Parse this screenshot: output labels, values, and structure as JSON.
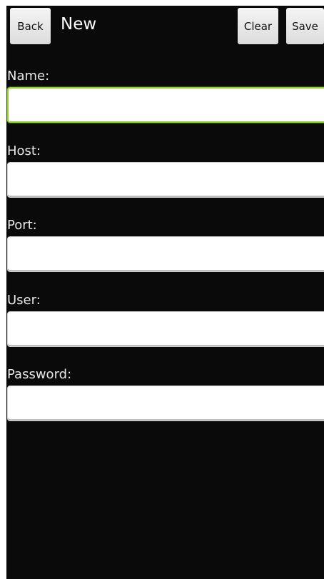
{
  "toolbar": {
    "back_label": "Back",
    "title": "New",
    "clear_label": "Clear",
    "save_label": "Save"
  },
  "form": {
    "name_label": "Name:",
    "name_value": "",
    "host_label": "Host:",
    "host_value": "",
    "port_label": "Port:",
    "port_value": "",
    "user_label": "User:",
    "user_value": "",
    "password_label": "Password:",
    "password_value": ""
  },
  "colors": {
    "background": "#0a0a0a",
    "focus_accent": "#8fd12a"
  }
}
